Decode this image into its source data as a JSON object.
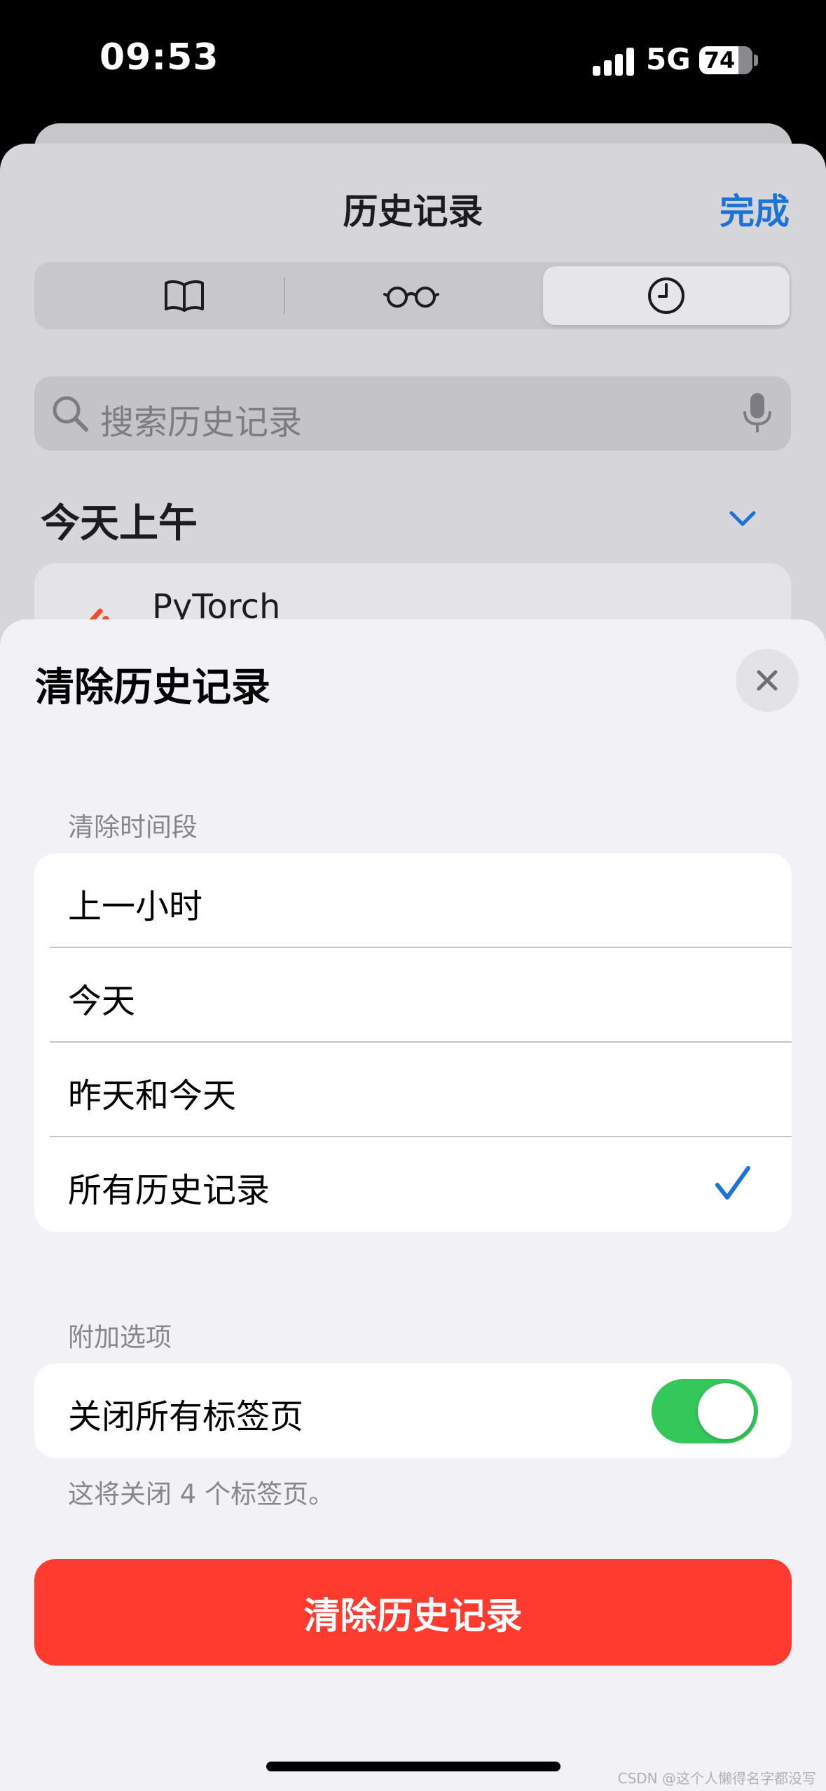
{
  "status_bar": {
    "time": "09:53",
    "network": "5G",
    "battery": "74"
  },
  "history_sheet": {
    "title": "历史记录",
    "done_label": "完成",
    "tabs": [
      {
        "icon": "book-icon",
        "active": false
      },
      {
        "icon": "glasses-icon",
        "active": false
      },
      {
        "icon": "clock-icon",
        "active": true
      }
    ],
    "search_placeholder": "搜索历史记录",
    "section_title": "今天上午",
    "first_item_title": "PyTorch"
  },
  "clear_sheet": {
    "title": "清除历史记录",
    "timeframe_label": "清除时间段",
    "timeframe_options": [
      {
        "label": "上一小时",
        "selected": false
      },
      {
        "label": "今天",
        "selected": false
      },
      {
        "label": "昨天和今天",
        "selected": false
      },
      {
        "label": "所有历史记录",
        "selected": true
      }
    ],
    "extra_label": "附加选项",
    "close_tabs_label": "关闭所有标签页",
    "close_tabs_on": true,
    "footnote": "这将关闭 4 个标签页。",
    "clear_button_label": "清除历史记录"
  },
  "watermark": "CSDN @这个人懒得名字都没写",
  "colors": {
    "accent": "#1a73d9",
    "destructive": "#ff3b30",
    "toggle_on": "#34c759"
  }
}
